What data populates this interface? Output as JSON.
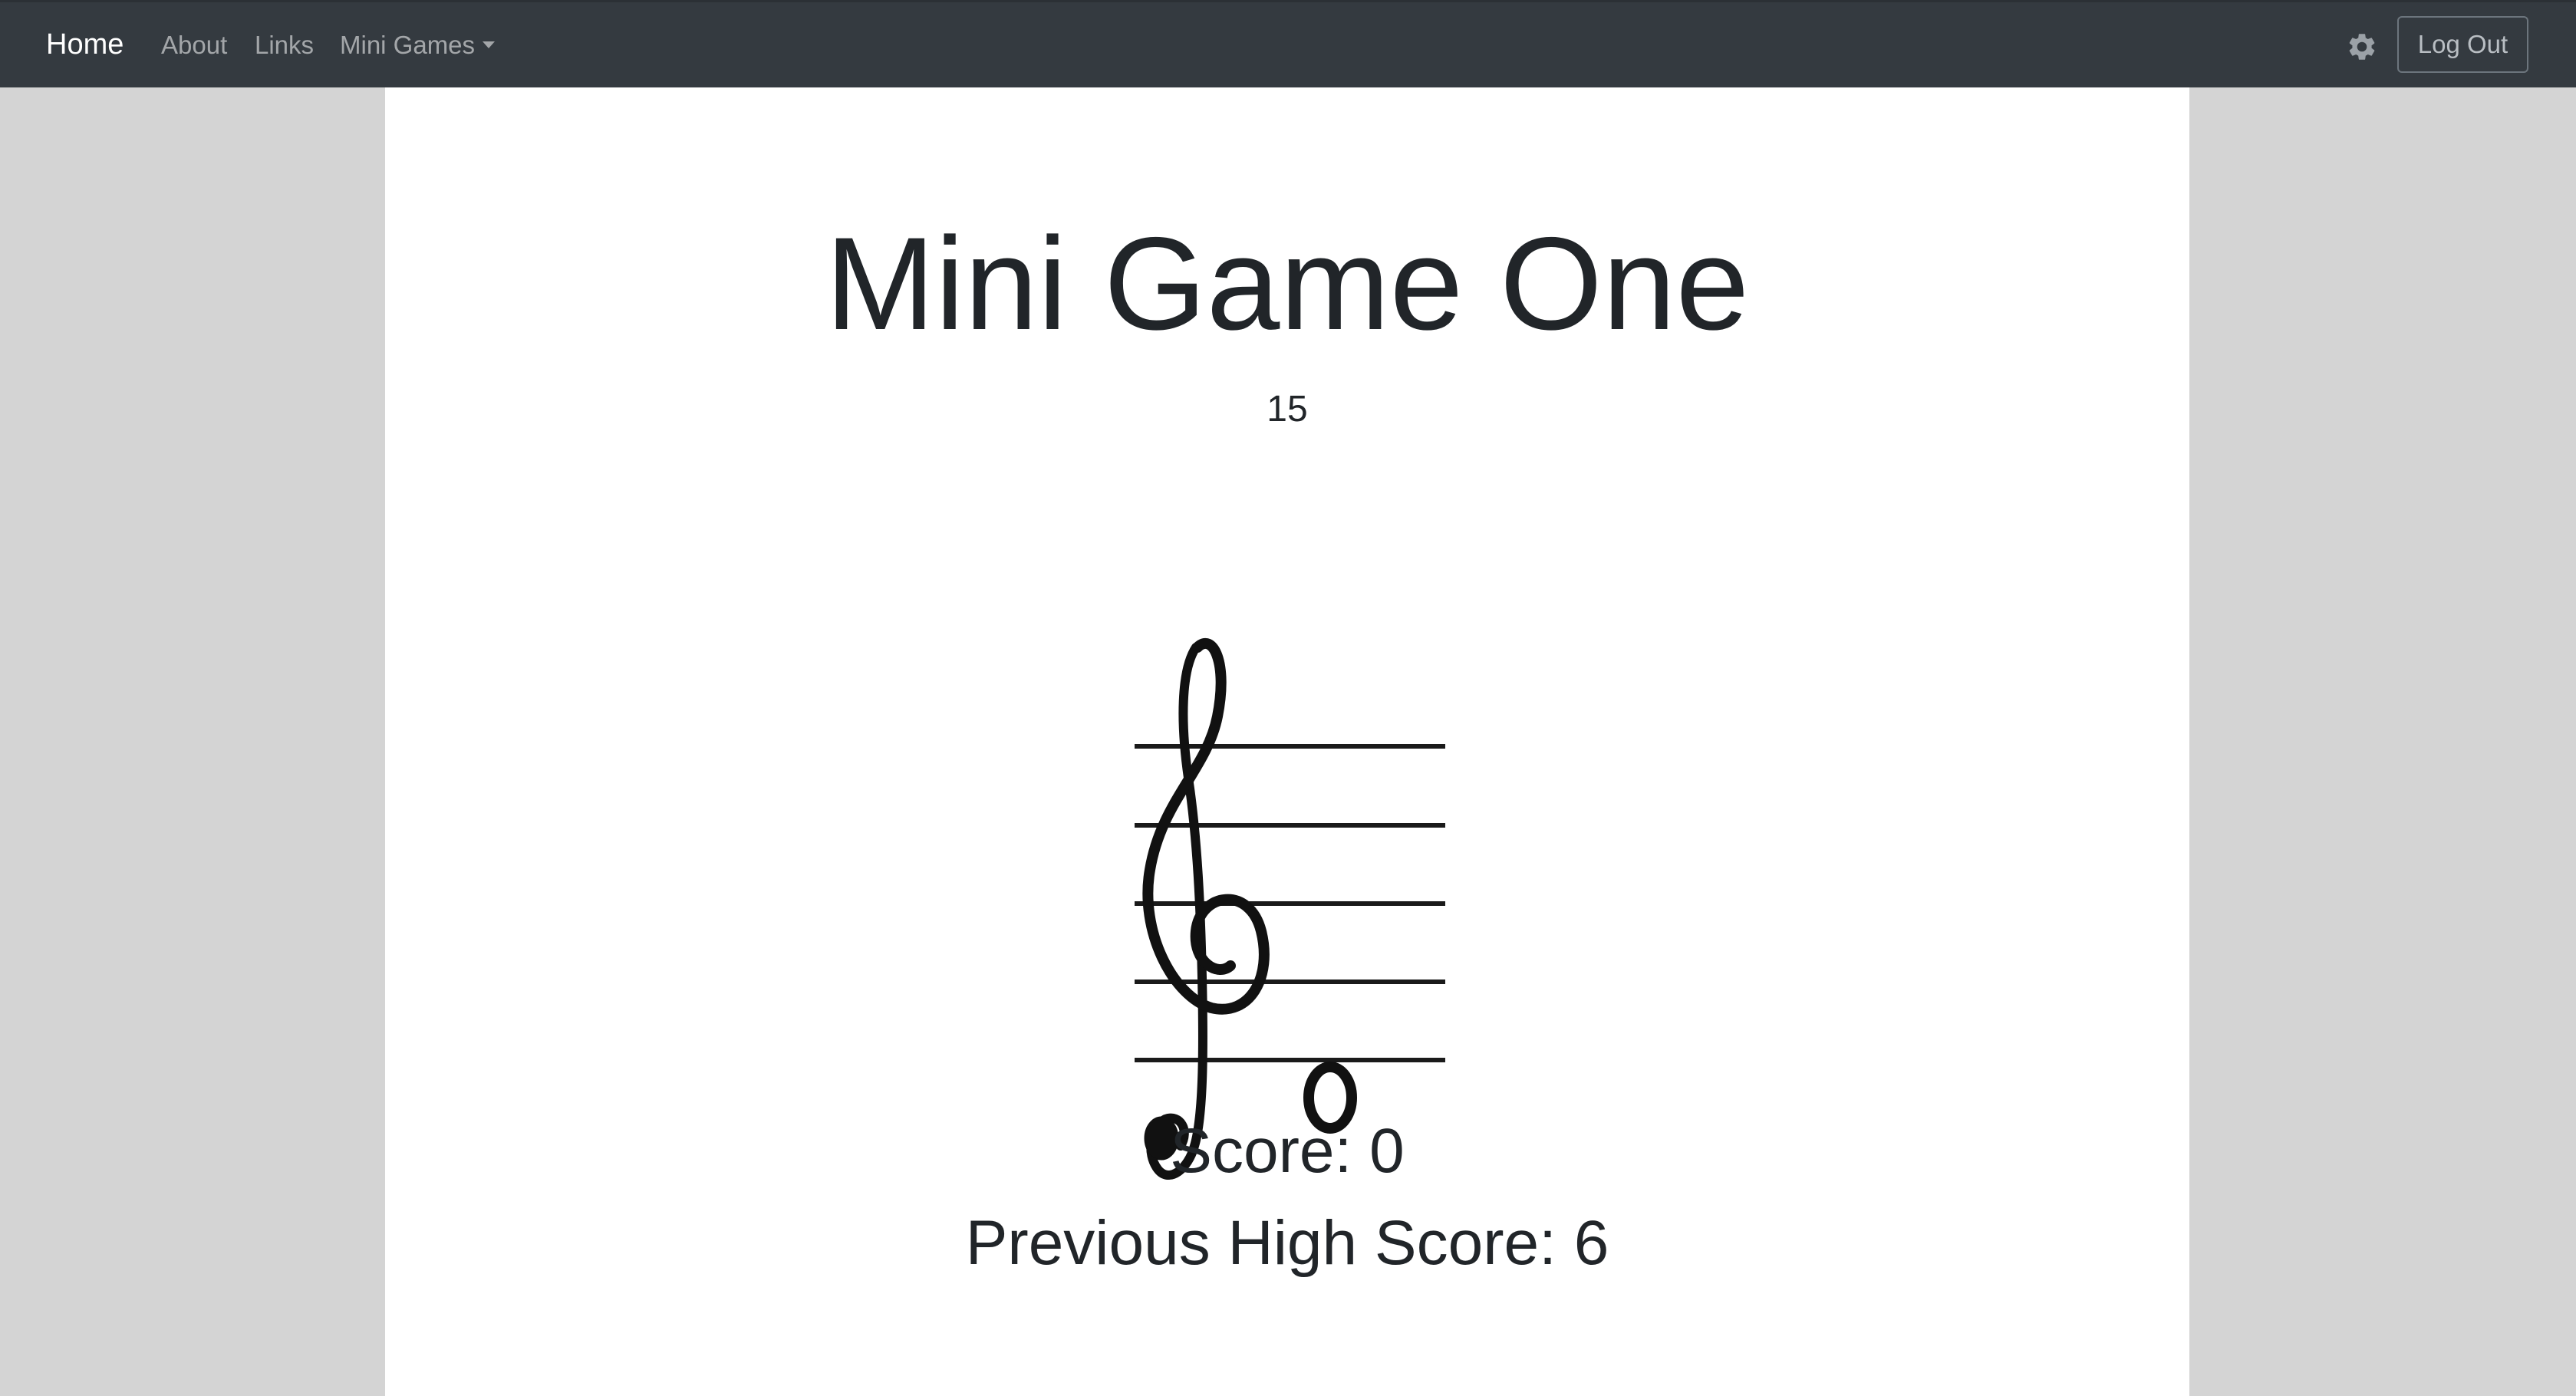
{
  "navbar": {
    "brand": "Home",
    "links": [
      "About",
      "Links"
    ],
    "dropdown_label": "Mini Games",
    "settings_icon": "gear-icon",
    "logout_label": "Log Out"
  },
  "game": {
    "title": "Mini Game One",
    "timer": "15",
    "score_text": "Score: 0",
    "high_score_text": "Previous High Score: 6"
  },
  "colors": {
    "navbar_bg": "#343a40",
    "page_bg": "#d4d4d4",
    "content_bg": "#ffffff",
    "text": "#212529"
  }
}
